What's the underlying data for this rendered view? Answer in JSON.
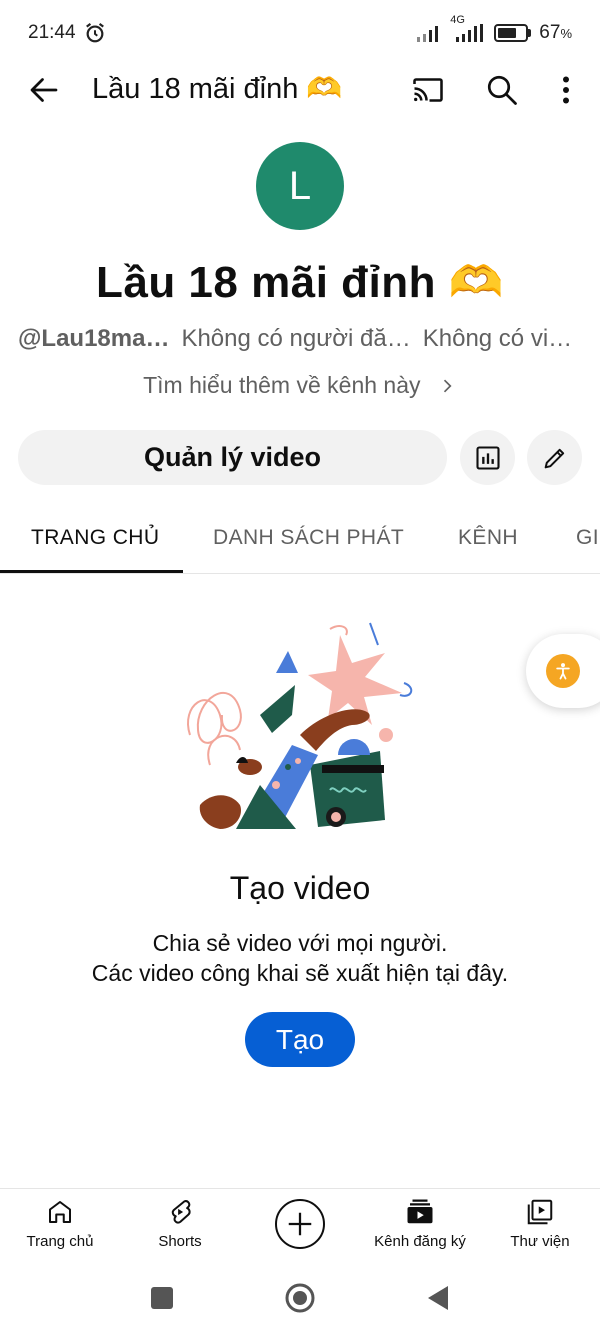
{
  "status_bar": {
    "time": "21:44",
    "network": "4G",
    "battery_percent": "67",
    "battery_unit": "%",
    "battery_level": 0.67,
    "icons": [
      "alarm-icon",
      "signal-icon",
      "signal-4g-icon",
      "battery-icon"
    ]
  },
  "app_bar": {
    "title": "Lầu 18 mãi đỉnh 🫶",
    "icons": [
      "back-arrow-icon",
      "cast-icon",
      "search-icon",
      "more-vert-icon"
    ]
  },
  "channel": {
    "avatar_letter": "L",
    "avatar_color": "#1f8a6c",
    "name": "Lầu 18 mãi đỉnh 🫶",
    "handle": "@Lau18ma…",
    "subscribers": "Không có người đă…",
    "videos": "Không có vi…",
    "learn_more": "Tìm hiểu thêm về kênh này"
  },
  "actions": {
    "manage_video": "Quản lý video",
    "icons": [
      "analytics-icon",
      "edit-pencil-icon"
    ]
  },
  "tabs": [
    {
      "label": "TRANG CHỦ",
      "active": true
    },
    {
      "label": "DANH SÁCH PHÁT",
      "active": false
    },
    {
      "label": "KÊNH",
      "active": false
    },
    {
      "label": "GIỚI THIỆU",
      "active": false
    }
  ],
  "empty_state": {
    "title": "Tạo video",
    "description_line1": "Chia sẻ video với mọi người.",
    "description_line2": "Các video công khai sẽ xuất hiện tại đây.",
    "create_button": "Tạo"
  },
  "bottom_nav": {
    "home": "Trang chủ",
    "shorts": "Shorts",
    "subscriptions": "Kênh đăng ký",
    "library": "Thư viện",
    "icons": [
      "home-icon",
      "shorts-icon",
      "create-plus-icon",
      "subscriptions-icon",
      "library-icon"
    ]
  },
  "colors": {
    "accent_blue": "#065fd4",
    "accessibility_orange": "#f5a623",
    "text_primary": "#0f0f0f",
    "text_secondary": "#606060"
  }
}
